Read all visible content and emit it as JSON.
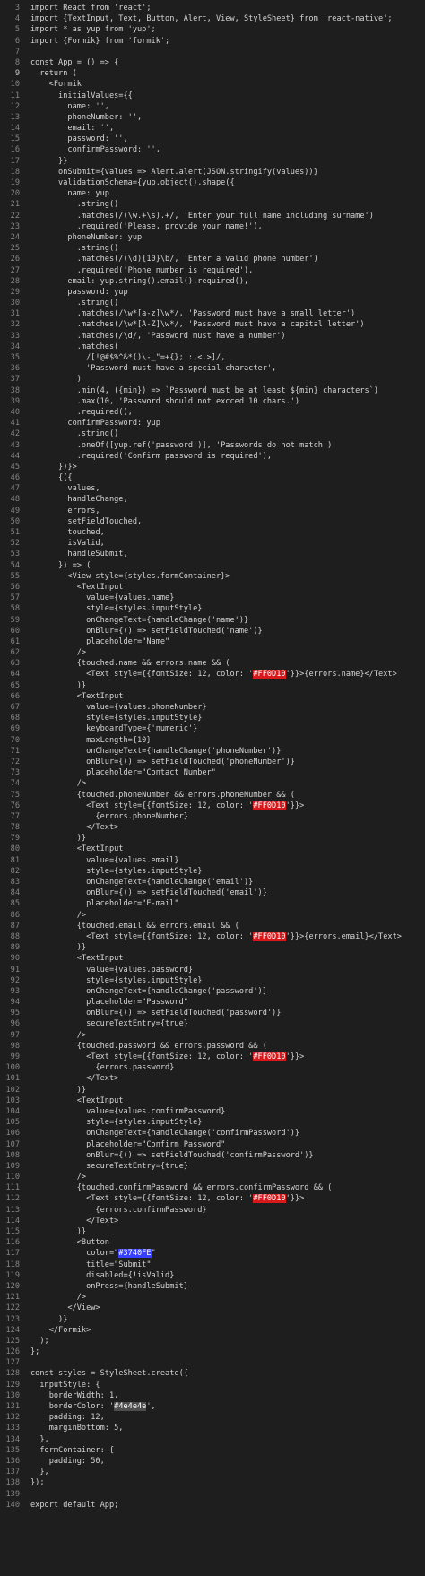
{
  "editor": {
    "language": "javascript",
    "active_line": 9,
    "lines": [
      {
        "n": "3",
        "t": "import React from 'react';"
      },
      {
        "n": "4",
        "t": "import {TextInput, Text, Button, Alert, View, StyleSheet} from 'react-native';"
      },
      {
        "n": "5",
        "t": "import * as yup from 'yup';"
      },
      {
        "n": "6",
        "t": "import {Formik} from 'formik';"
      },
      {
        "n": "7",
        "t": ""
      },
      {
        "n": "8",
        "t": "const App = () => {"
      },
      {
        "n": "9",
        "t": "  return ("
      },
      {
        "n": "10",
        "t": "    <Formik"
      },
      {
        "n": "11",
        "t": "      initialValues={{"
      },
      {
        "n": "12",
        "t": "        name: '',"
      },
      {
        "n": "13",
        "t": "        phoneNumber: '',"
      },
      {
        "n": "14",
        "t": "        email: '',"
      },
      {
        "n": "15",
        "t": "        password: '',"
      },
      {
        "n": "16",
        "t": "        confirmPassword: '',"
      },
      {
        "n": "17",
        "t": "      }}"
      },
      {
        "n": "18",
        "t": "      onSubmit={values => Alert.alert(JSON.stringify(values))}"
      },
      {
        "n": "19",
        "t": "      validationSchema={yup.object().shape({"
      },
      {
        "n": "20",
        "t": "        name: yup"
      },
      {
        "n": "21",
        "t": "          .string()"
      },
      {
        "n": "22",
        "t": "          .matches(/(\\w.+\\s).+/, 'Enter your full name including surname')"
      },
      {
        "n": "23",
        "t": "          .required('Please, provide your name!'),"
      },
      {
        "n": "24",
        "t": "        phoneNumber: yup"
      },
      {
        "n": "25",
        "t": "          .string()"
      },
      {
        "n": "26",
        "t": "          .matches(/(\\d){10}\\b/, 'Enter a valid phone number')"
      },
      {
        "n": "27",
        "t": "          .required('Phone number is required'),"
      },
      {
        "n": "28",
        "t": "        email: yup.string().email().required(),"
      },
      {
        "n": "29",
        "t": "        password: yup"
      },
      {
        "n": "30",
        "t": "          .string()"
      },
      {
        "n": "31",
        "t": "          .matches(/\\w*[a-z]\\w*/, 'Password must have a small letter')"
      },
      {
        "n": "32",
        "t": "          .matches(/\\w*[A-Z]\\w*/, 'Password must have a capital letter')"
      },
      {
        "n": "33",
        "t": "          .matches(/\\d/, 'Password must have a number')"
      },
      {
        "n": "34",
        "t": "          .matches("
      },
      {
        "n": "35",
        "t": "            /[!@#$%^&*()\\-_\"=+{}; :,<.>]/,"
      },
      {
        "n": "36",
        "t": "            'Password must have a special character',"
      },
      {
        "n": "37",
        "t": "          )"
      },
      {
        "n": "38",
        "t": "          .min(4, ({min}) => `Password must be at least ${min} characters`)"
      },
      {
        "n": "39",
        "t": "          .max(10, 'Password should not excced 10 chars.')"
      },
      {
        "n": "40",
        "t": "          .required(),"
      },
      {
        "n": "41",
        "t": "        confirmPassword: yup"
      },
      {
        "n": "42",
        "t": "          .string()"
      },
      {
        "n": "43",
        "t": "          .oneOf([yup.ref('password')], 'Passwords do not match')"
      },
      {
        "n": "44",
        "t": "          .required('Confirm password is required'),"
      },
      {
        "n": "45",
        "t": "      })}>"
      },
      {
        "n": "46",
        "t": "      {({"
      },
      {
        "n": "47",
        "t": "        values,"
      },
      {
        "n": "48",
        "t": "        handleChange,"
      },
      {
        "n": "49",
        "t": "        errors,"
      },
      {
        "n": "50",
        "t": "        setFieldTouched,"
      },
      {
        "n": "51",
        "t": "        touched,"
      },
      {
        "n": "52",
        "t": "        isValid,"
      },
      {
        "n": "53",
        "t": "        handleSubmit,"
      },
      {
        "n": "54",
        "t": "      }) => ("
      },
      {
        "n": "55",
        "t": "        <View style={styles.formContainer}>"
      },
      {
        "n": "56",
        "t": "          <TextInput"
      },
      {
        "n": "57",
        "t": "            value={values.name}"
      },
      {
        "n": "58",
        "t": "            style={styles.inputStyle}"
      },
      {
        "n": "59",
        "t": "            onChangeText={handleChange('name')}"
      },
      {
        "n": "60",
        "t": "            onBlur={() => setFieldTouched('name')}"
      },
      {
        "n": "61",
        "t": "            placeholder=\"Name\""
      },
      {
        "n": "62",
        "t": "          />"
      },
      {
        "n": "63",
        "t": "          {touched.name && errors.name && ("
      },
      {
        "n": "64",
        "t": "            <Text style={{fontSize: 12, color: '#FF0D10'}}>{errors.name}</Text>"
      },
      {
        "n": "65",
        "t": "          )}"
      },
      {
        "n": "66",
        "t": "          <TextInput"
      },
      {
        "n": "67",
        "t": "            value={values.phoneNumber}"
      },
      {
        "n": "68",
        "t": "            style={styles.inputStyle}"
      },
      {
        "n": "69",
        "t": "            keyboardType={'numeric'}"
      },
      {
        "n": "70",
        "t": "            maxLength={10}"
      },
      {
        "n": "71",
        "t": "            onChangeText={handleChange('phoneNumber')}"
      },
      {
        "n": "72",
        "t": "            onBlur={() => setFieldTouched('phoneNumber')}"
      },
      {
        "n": "73",
        "t": "            placeholder=\"Contact Number\""
      },
      {
        "n": "74",
        "t": "          />"
      },
      {
        "n": "75",
        "t": "          {touched.phoneNumber && errors.phoneNumber && ("
      },
      {
        "n": "76",
        "t": "            <Text style={{fontSize: 12, color: '#FF0D10'}}>"
      },
      {
        "n": "77",
        "t": "              {errors.phoneNumber}"
      },
      {
        "n": "78",
        "t": "            </Text>"
      },
      {
        "n": "79",
        "t": "          )}"
      },
      {
        "n": "80",
        "t": "          <TextInput"
      },
      {
        "n": "81",
        "t": "            value={values.email}"
      },
      {
        "n": "82",
        "t": "            style={styles.inputStyle}"
      },
      {
        "n": "83",
        "t": "            onChangeText={handleChange('email')}"
      },
      {
        "n": "84",
        "t": "            onBlur={() => setFieldTouched('email')}"
      },
      {
        "n": "85",
        "t": "            placeholder=\"E-mail\""
      },
      {
        "n": "86",
        "t": "          />"
      },
      {
        "n": "87",
        "t": "          {touched.email && errors.email && ("
      },
      {
        "n": "88",
        "t": "            <Text style={{fontSize: 12, color: '#FF0D10'}}>{errors.email}</Text>"
      },
      {
        "n": "89",
        "t": "          )}"
      },
      {
        "n": "90",
        "t": "          <TextInput"
      },
      {
        "n": "91",
        "t": "            value={values.password}"
      },
      {
        "n": "92",
        "t": "            style={styles.inputStyle}"
      },
      {
        "n": "93",
        "t": "            onChangeText={handleChange('password')}"
      },
      {
        "n": "94",
        "t": "            placeholder=\"Password\""
      },
      {
        "n": "95",
        "t": "            onBlur={() => setFieldTouched('password')}"
      },
      {
        "n": "96",
        "t": "            secureTextEntry={true}"
      },
      {
        "n": "97",
        "t": "          />"
      },
      {
        "n": "98",
        "t": "          {touched.password && errors.password && ("
      },
      {
        "n": "99",
        "t": "            <Text style={{fontSize: 12, color: '#FF0D10'}}>"
      },
      {
        "n": "100",
        "t": "              {errors.password}"
      },
      {
        "n": "101",
        "t": "            </Text>"
      },
      {
        "n": "102",
        "t": "          )}"
      },
      {
        "n": "103",
        "t": "          <TextInput"
      },
      {
        "n": "104",
        "t": "            value={values.confirmPassword}"
      },
      {
        "n": "105",
        "t": "            style={styles.inputStyle}"
      },
      {
        "n": "106",
        "t": "            onChangeText={handleChange('confirmPassword')}"
      },
      {
        "n": "107",
        "t": "            placeholder=\"Confirm Password\""
      },
      {
        "n": "108",
        "t": "            onBlur={() => setFieldTouched('confirmPassword')}"
      },
      {
        "n": "109",
        "t": "            secureTextEntry={true}"
      },
      {
        "n": "110",
        "t": "          />"
      },
      {
        "n": "111",
        "t": "          {touched.confirmPassword && errors.confirmPassword && ("
      },
      {
        "n": "112",
        "t": "            <Text style={{fontSize: 12, color: '#FF0D10'}}>"
      },
      {
        "n": "113",
        "t": "              {errors.confirmPassword}"
      },
      {
        "n": "114",
        "t": "            </Text>"
      },
      {
        "n": "115",
        "t": "          )}"
      },
      {
        "n": "116",
        "t": "          <Button"
      },
      {
        "n": "117",
        "t": "            color=\"#3740FE\""
      },
      {
        "n": "118",
        "t": "            title=\"Submit\""
      },
      {
        "n": "119",
        "t": "            disabled={!isValid}"
      },
      {
        "n": "120",
        "t": "            onPress={handleSubmit}"
      },
      {
        "n": "121",
        "t": "          />"
      },
      {
        "n": "122",
        "t": "        </View>"
      },
      {
        "n": "123",
        "t": "      )}"
      },
      {
        "n": "124",
        "t": "    </Formik>"
      },
      {
        "n": "125",
        "t": "  );"
      },
      {
        "n": "126",
        "t": "};"
      },
      {
        "n": "127",
        "t": ""
      },
      {
        "n": "128",
        "t": "const styles = StyleSheet.create({"
      },
      {
        "n": "129",
        "t": "  inputStyle: {"
      },
      {
        "n": "130",
        "t": "    borderWidth: 1,"
      },
      {
        "n": "131",
        "t": "    borderColor: '#4e4e4e',"
      },
      {
        "n": "132",
        "t": "    padding: 12,"
      },
      {
        "n": "133",
        "t": "    marginBottom: 5,"
      },
      {
        "n": "134",
        "t": "  },"
      },
      {
        "n": "135",
        "t": "  formContainer: {"
      },
      {
        "n": "136",
        "t": "    padding: 50,"
      },
      {
        "n": "137",
        "t": "  },"
      },
      {
        "n": "138",
        "t": "});"
      },
      {
        "n": "139",
        "t": ""
      },
      {
        "n": "140",
        "t": "export default App;"
      }
    ]
  },
  "colors": {
    "background": "#1e1e1e",
    "line_number": "#858585",
    "error_color_swatch": "#FF0D10",
    "button_color_swatch": "#3740FE",
    "border_color_swatch": "#4e4e4e"
  }
}
